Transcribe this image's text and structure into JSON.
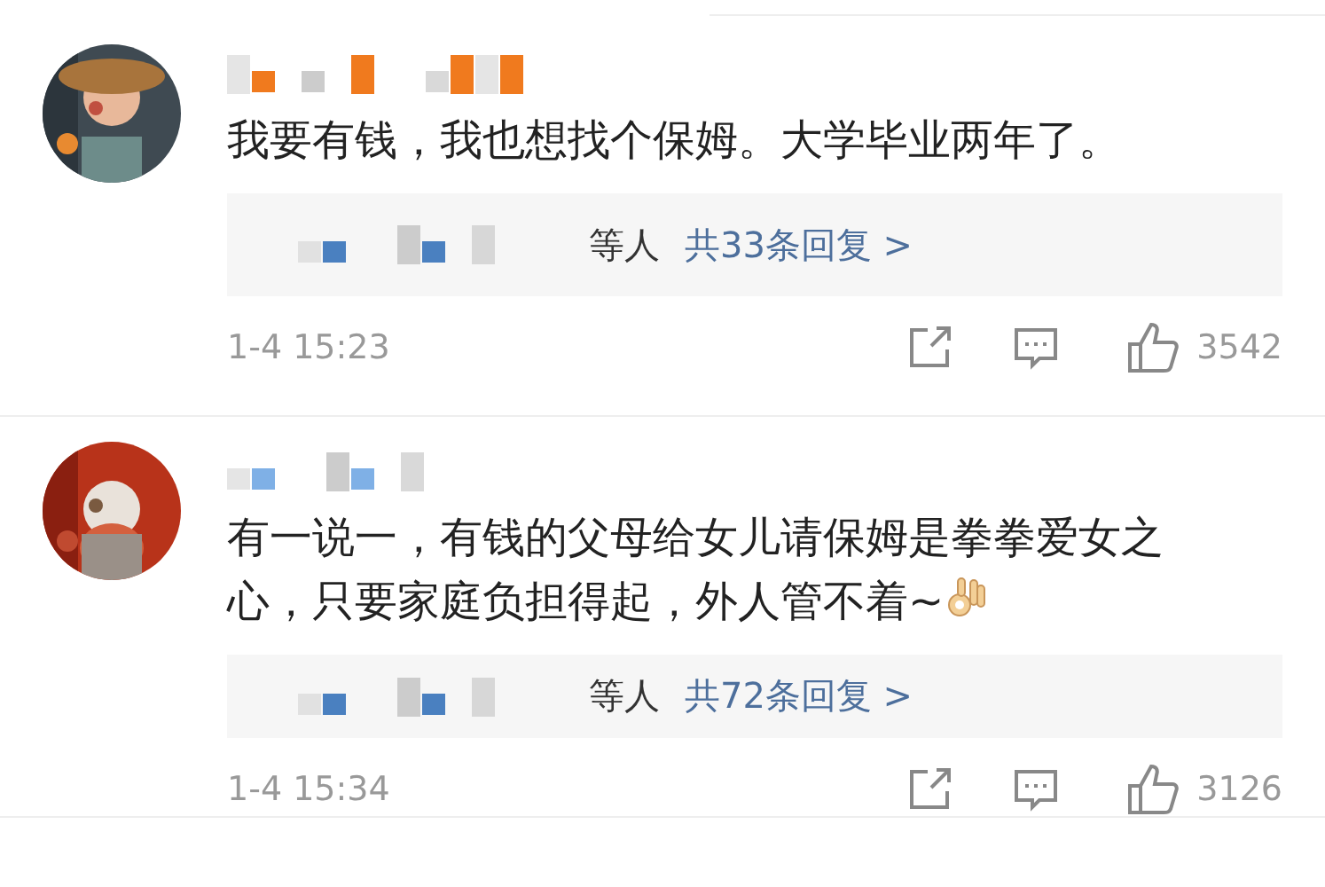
{
  "comments": [
    {
      "color": "#f07a1e",
      "text": "我要有钱，我也想找个保姆。大学毕业两年了。",
      "emoji": false,
      "replies_suffix": "等人",
      "replies_link": "共33条回复 >",
      "time": "1-4 15:23",
      "likes": "3542"
    },
    {
      "color": "#7fb0e6",
      "text": "有一说一，有钱的父母给女儿请保姆是拳拳爱女之心，只要家庭负担得起，外人管不着~",
      "emoji": true,
      "replies_suffix": "等人",
      "replies_link": "共72条回复 >",
      "time": "1-4 15:34",
      "likes": "3126"
    }
  ]
}
